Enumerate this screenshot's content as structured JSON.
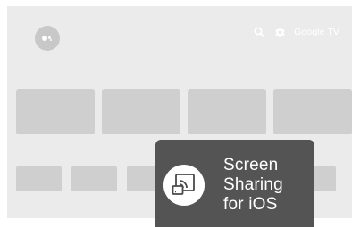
{
  "topbar": {
    "brand": "Google TV",
    "icons": [
      "search-icon",
      "gear-icon",
      "assistant-icon"
    ]
  },
  "overlay": {
    "lines": [
      "Screen",
      "Sharing",
      "for iOS"
    ],
    "icon": "cast-icon"
  },
  "colors": {
    "screen_background": "#ebebeb",
    "card": "#cfcfcf",
    "overlay_background": "#545454",
    "icon_circle": "#ffffff"
  }
}
